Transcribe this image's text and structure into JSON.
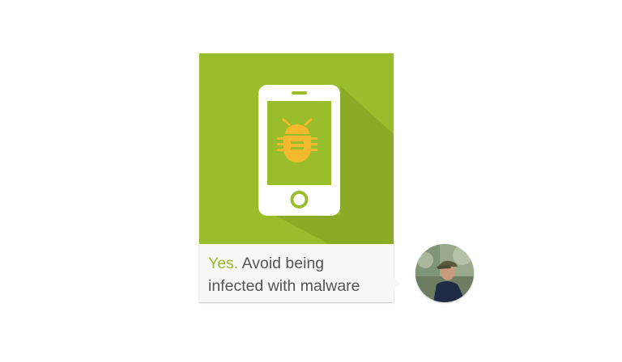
{
  "message": {
    "emphasis": "Yes.",
    "text_line1": "Avoid being",
    "text_line2": "infected with malware"
  },
  "hero": {
    "icon": "phone-with-bug-icon",
    "background_color": "#9abd2c",
    "bug_color": "#f4b92c"
  },
  "avatar": {
    "icon": "user-avatar-photo"
  }
}
